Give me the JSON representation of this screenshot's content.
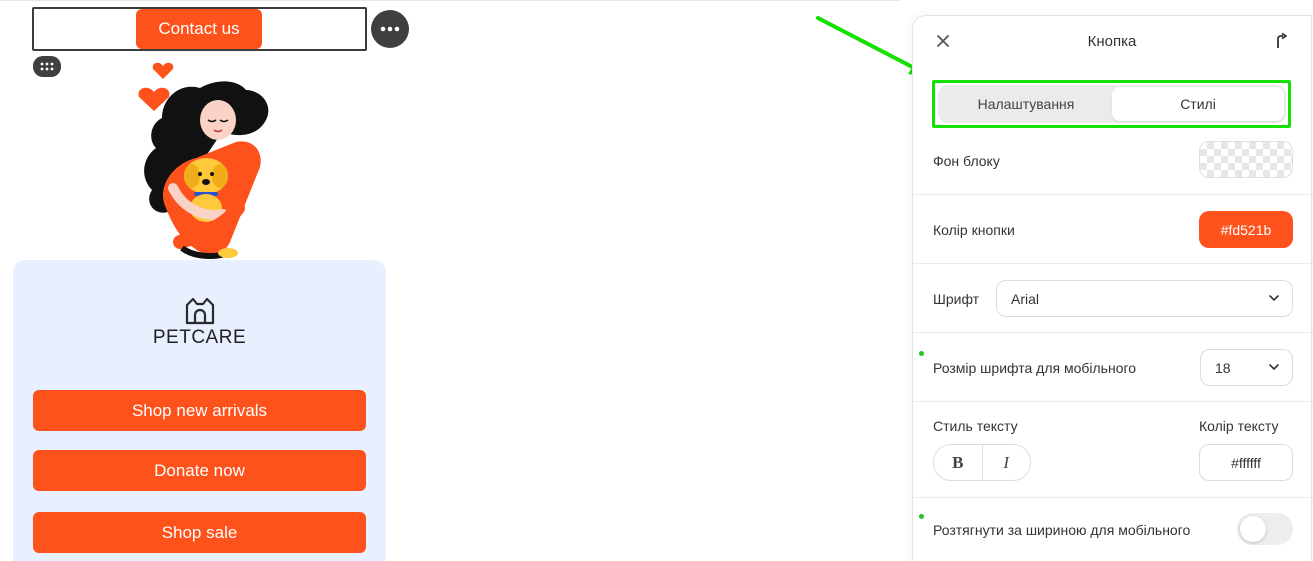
{
  "canvas": {
    "contact_button": "Contact us",
    "logo_text": "PETCARE",
    "buttons": [
      "Shop new arrivals",
      "Donate now",
      "Shop sale"
    ]
  },
  "panel": {
    "title": "Кнопка",
    "tabs": [
      {
        "label": "Налаштування",
        "active": false
      },
      {
        "label": "Стилі",
        "active": true
      }
    ],
    "block_bg": {
      "label": "Фон блоку",
      "value": "transparent"
    },
    "button_color": {
      "label": "Колір кнопки",
      "value": "#fd521b"
    },
    "font": {
      "label": "Шрифт",
      "value": "Arial"
    },
    "mobile_font_size": {
      "label": "Розмір шрифта для мобільного",
      "value": "18"
    },
    "text_style": {
      "label": "Стиль тексту",
      "bold": "B",
      "italic": "I"
    },
    "text_color": {
      "label": "Колір тексту",
      "value": "#ffffff"
    },
    "stretch_mobile": {
      "label": "Розтягнути за шириною для мобільного",
      "enabled": false
    }
  },
  "colors": {
    "accent": "#fd521b",
    "highlight": "#15e000",
    "card_bg": "#e8efff"
  }
}
